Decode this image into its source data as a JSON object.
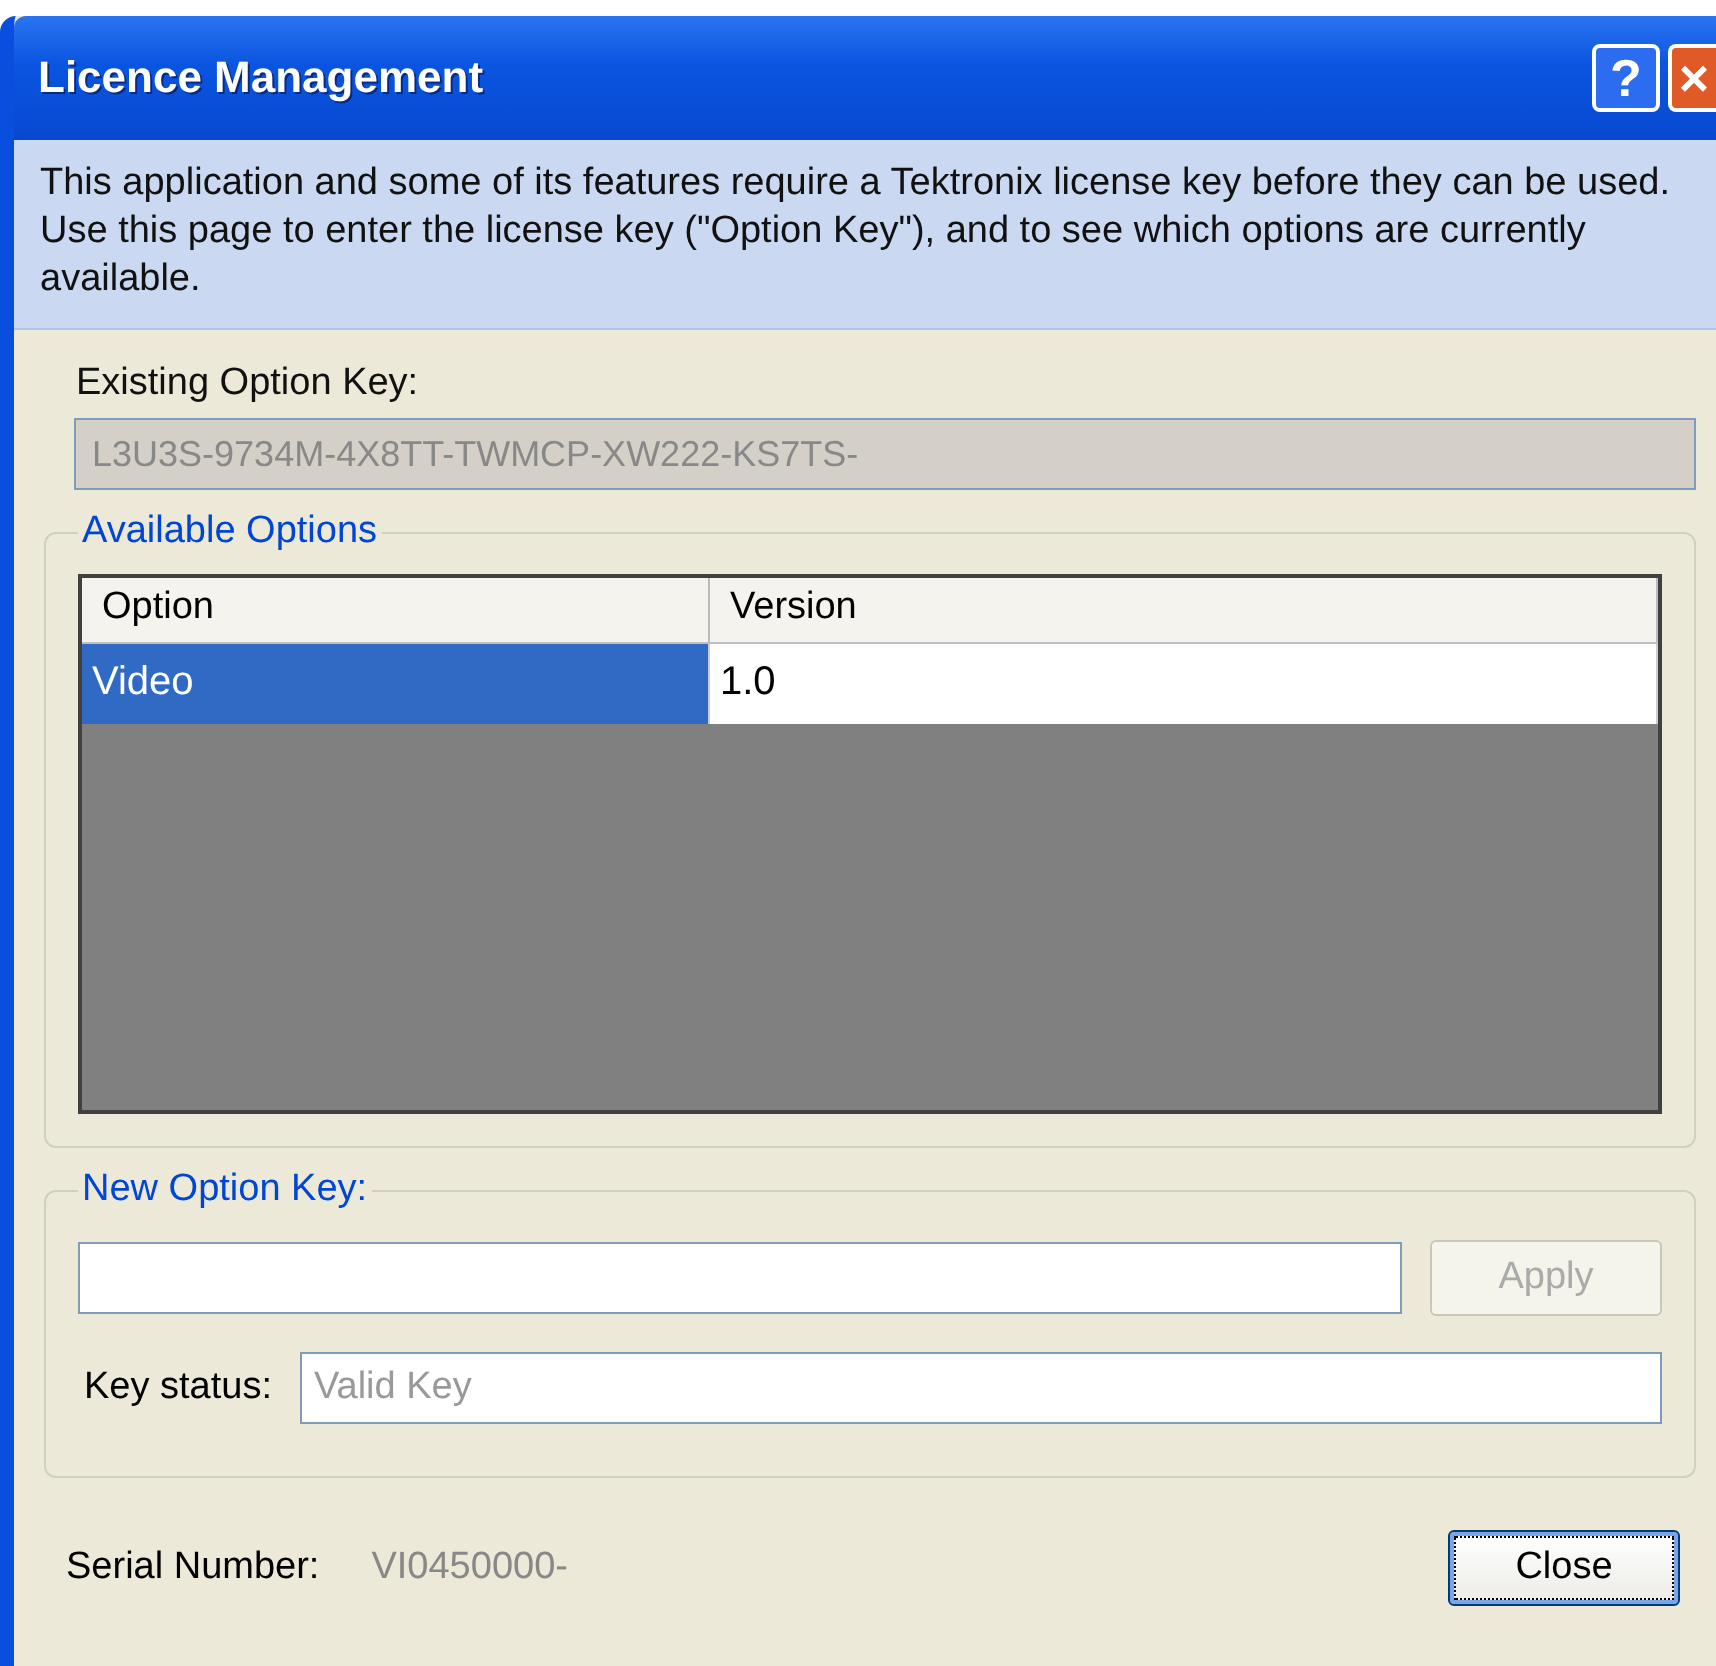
{
  "window": {
    "title": "Licence Management",
    "buttons": [
      {
        "kind": "help",
        "label": "?"
      },
      {
        "kind": "close",
        "label": "×"
      }
    ]
  },
  "intro": "This application and some of its features require a Tektronix license key before they can be used. Use this page to enter the license key (\"Option Key\"), and to see which options are currently available.",
  "existing_key": {
    "label": "Existing Option Key:",
    "value": "L3U3S-9734M-4X8TT-TWMCP-XW222-KS7TS-"
  },
  "available_options": {
    "title": "Available Options",
    "columns": [
      "Option",
      "Version"
    ],
    "rows": [
      {
        "cells": [
          "Video",
          "1.0"
        ],
        "selected": true
      }
    ]
  },
  "new_key": {
    "title": "New Option Key:",
    "apply": {
      "label": "Apply",
      "disabled": true
    },
    "status_label": "Key status:",
    "status": {
      "value": "Valid Key",
      "disabled": true
    }
  },
  "serial": {
    "label": "Serial Number:",
    "value": "VI0450000-"
  },
  "close_button": {
    "label": "Close",
    "focused": true
  }
}
